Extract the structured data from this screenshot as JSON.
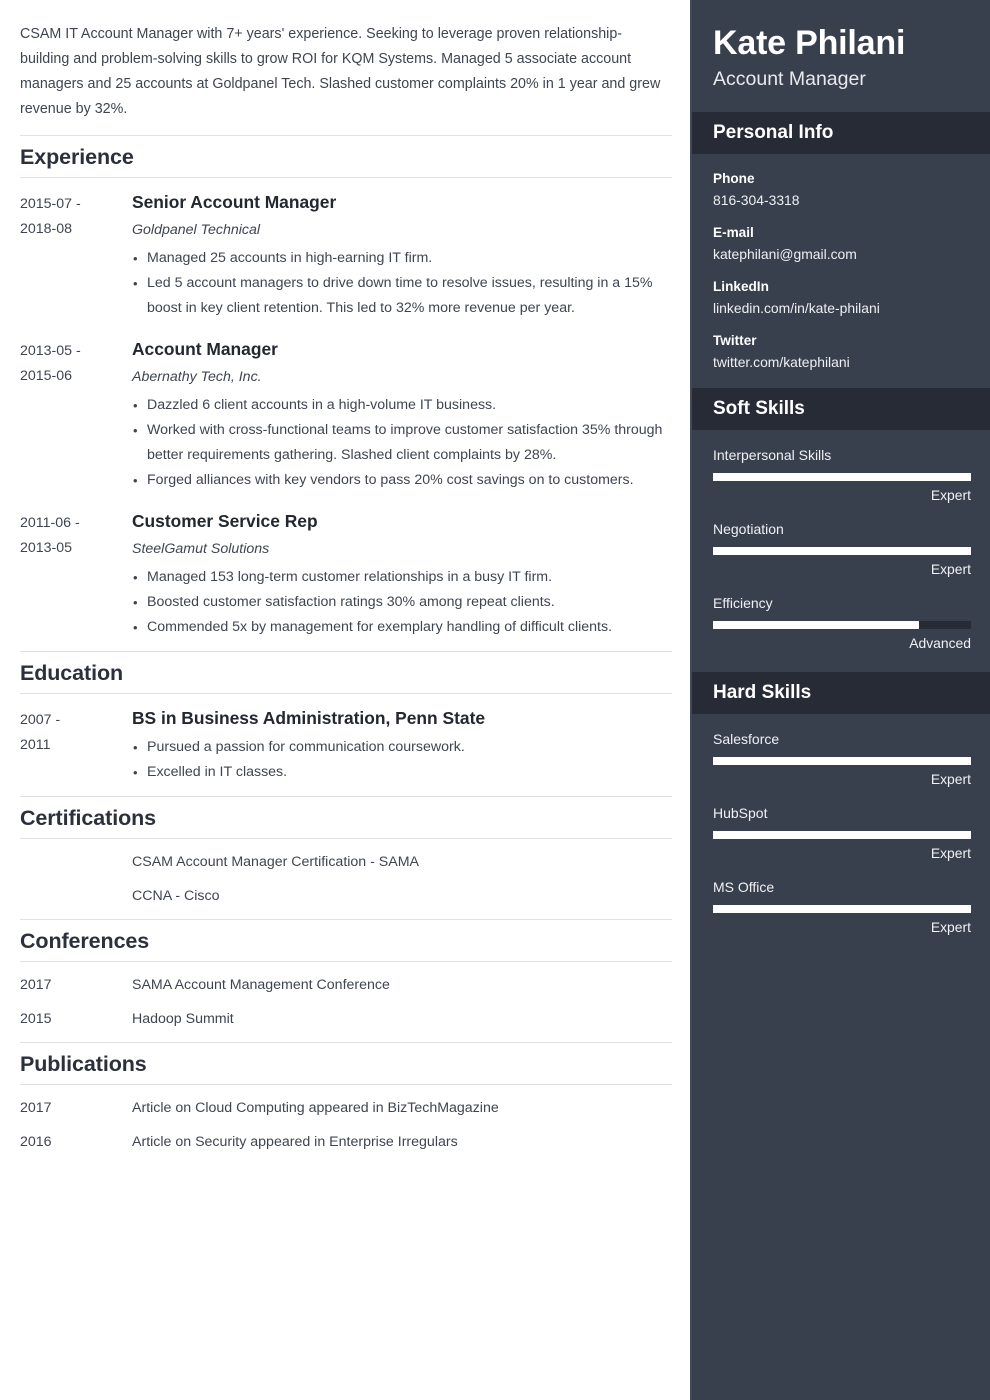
{
  "summary": "CSAM IT Account Manager with 7+ years' experience. Seeking to leverage proven relationship-building and problem-solving skills to grow ROI for KQM Systems. Managed 5 associate account managers and 25 accounts at Goldpanel Tech. Slashed customer complaints 20% in 1 year and grew revenue by 32%.",
  "sections": {
    "experience": {
      "heading": "Experience",
      "entries": [
        {
          "date_from": "2015-07 -",
          "date_to": "2018-08",
          "title": "Senior Account Manager",
          "subtitle": "Goldpanel Technical",
          "bullets": [
            "Managed 25 accounts in high-earning IT firm.",
            "Led 5 account managers to drive down time to resolve issues, resulting in a 15% boost in key client retention. This led to 32% more revenue per year."
          ]
        },
        {
          "date_from": "2013-05 -",
          "date_to": "2015-06",
          "title": "Account Manager",
          "subtitle": "Abernathy Tech, Inc.",
          "bullets": [
            "Dazzled 6 client accounts in a high-volume IT business.",
            "Worked with cross-functional teams to improve customer satisfaction 35% through better requirements gathering. Slashed client complaints by 28%.",
            "Forged alliances with key vendors to pass 20% cost savings on to customers."
          ]
        },
        {
          "date_from": "2011-06 -",
          "date_to": "2013-05",
          "title": "Customer Service Rep",
          "subtitle": "SteelGamut Solutions",
          "bullets": [
            "Managed 153 long-term customer relationships in a busy IT firm.",
            "Boosted customer satisfaction ratings 30% among repeat clients.",
            "Commended 5x by management for exemplary handling of difficult clients."
          ]
        }
      ]
    },
    "education": {
      "heading": "Education",
      "entries": [
        {
          "date_from": "2007 -",
          "date_to": "2011",
          "title": "BS in Business Administration, Penn State",
          "subtitle": "",
          "bullets": [
            "Pursued a passion for communication coursework.",
            "Excelled in IT classes."
          ]
        }
      ]
    },
    "certifications": {
      "heading": "Certifications",
      "rows": [
        {
          "date": "",
          "text": "CSAM Account Manager Certification - SAMA"
        },
        {
          "date": "",
          "text": "CCNA - Cisco"
        }
      ]
    },
    "conferences": {
      "heading": "Conferences",
      "rows": [
        {
          "date": "2017",
          "text": "SAMA Account Management Conference"
        },
        {
          "date": "2015",
          "text": "Hadoop Summit"
        }
      ]
    },
    "publications": {
      "heading": "Publications",
      "rows": [
        {
          "date": "2017",
          "text": "Article on Cloud Computing appeared in BizTechMagazine"
        },
        {
          "date": "2016",
          "text": "Article on Security appeared in Enterprise Irregulars"
        }
      ]
    }
  },
  "sidebar": {
    "name": "Kate Philani",
    "role": "Account Manager",
    "personal_info": {
      "heading": "Personal Info",
      "items": [
        {
          "label": "Phone",
          "value": "816-304-3318"
        },
        {
          "label": "E-mail",
          "value": "katephilani@gmail.com"
        },
        {
          "label": "LinkedIn",
          "value": "linkedin.com/in/kate-philani"
        },
        {
          "label": "Twitter",
          "value": "twitter.com/katephilani"
        }
      ]
    },
    "soft_skills": {
      "heading": "Soft Skills",
      "items": [
        {
          "name": "Interpersonal Skills",
          "level": "Expert",
          "percent": 100
        },
        {
          "name": "Negotiation",
          "level": "Expert",
          "percent": 100
        },
        {
          "name": "Efficiency",
          "level": "Advanced",
          "percent": 80
        }
      ]
    },
    "hard_skills": {
      "heading": "Hard Skills",
      "items": [
        {
          "name": "Salesforce",
          "level": "Expert",
          "percent": 100
        },
        {
          "name": "HubSpot",
          "level": "Expert",
          "percent": 100
        },
        {
          "name": "MS Office",
          "level": "Expert",
          "percent": 100
        }
      ]
    }
  },
  "colors": {
    "sidebar_bg": "#383f4d",
    "sidebar_band_bg": "#262b36",
    "text_dark": "#2b303b",
    "text_body": "#3f4550",
    "divider": "#dfe1e4",
    "bar_fill": "#ffffff"
  }
}
